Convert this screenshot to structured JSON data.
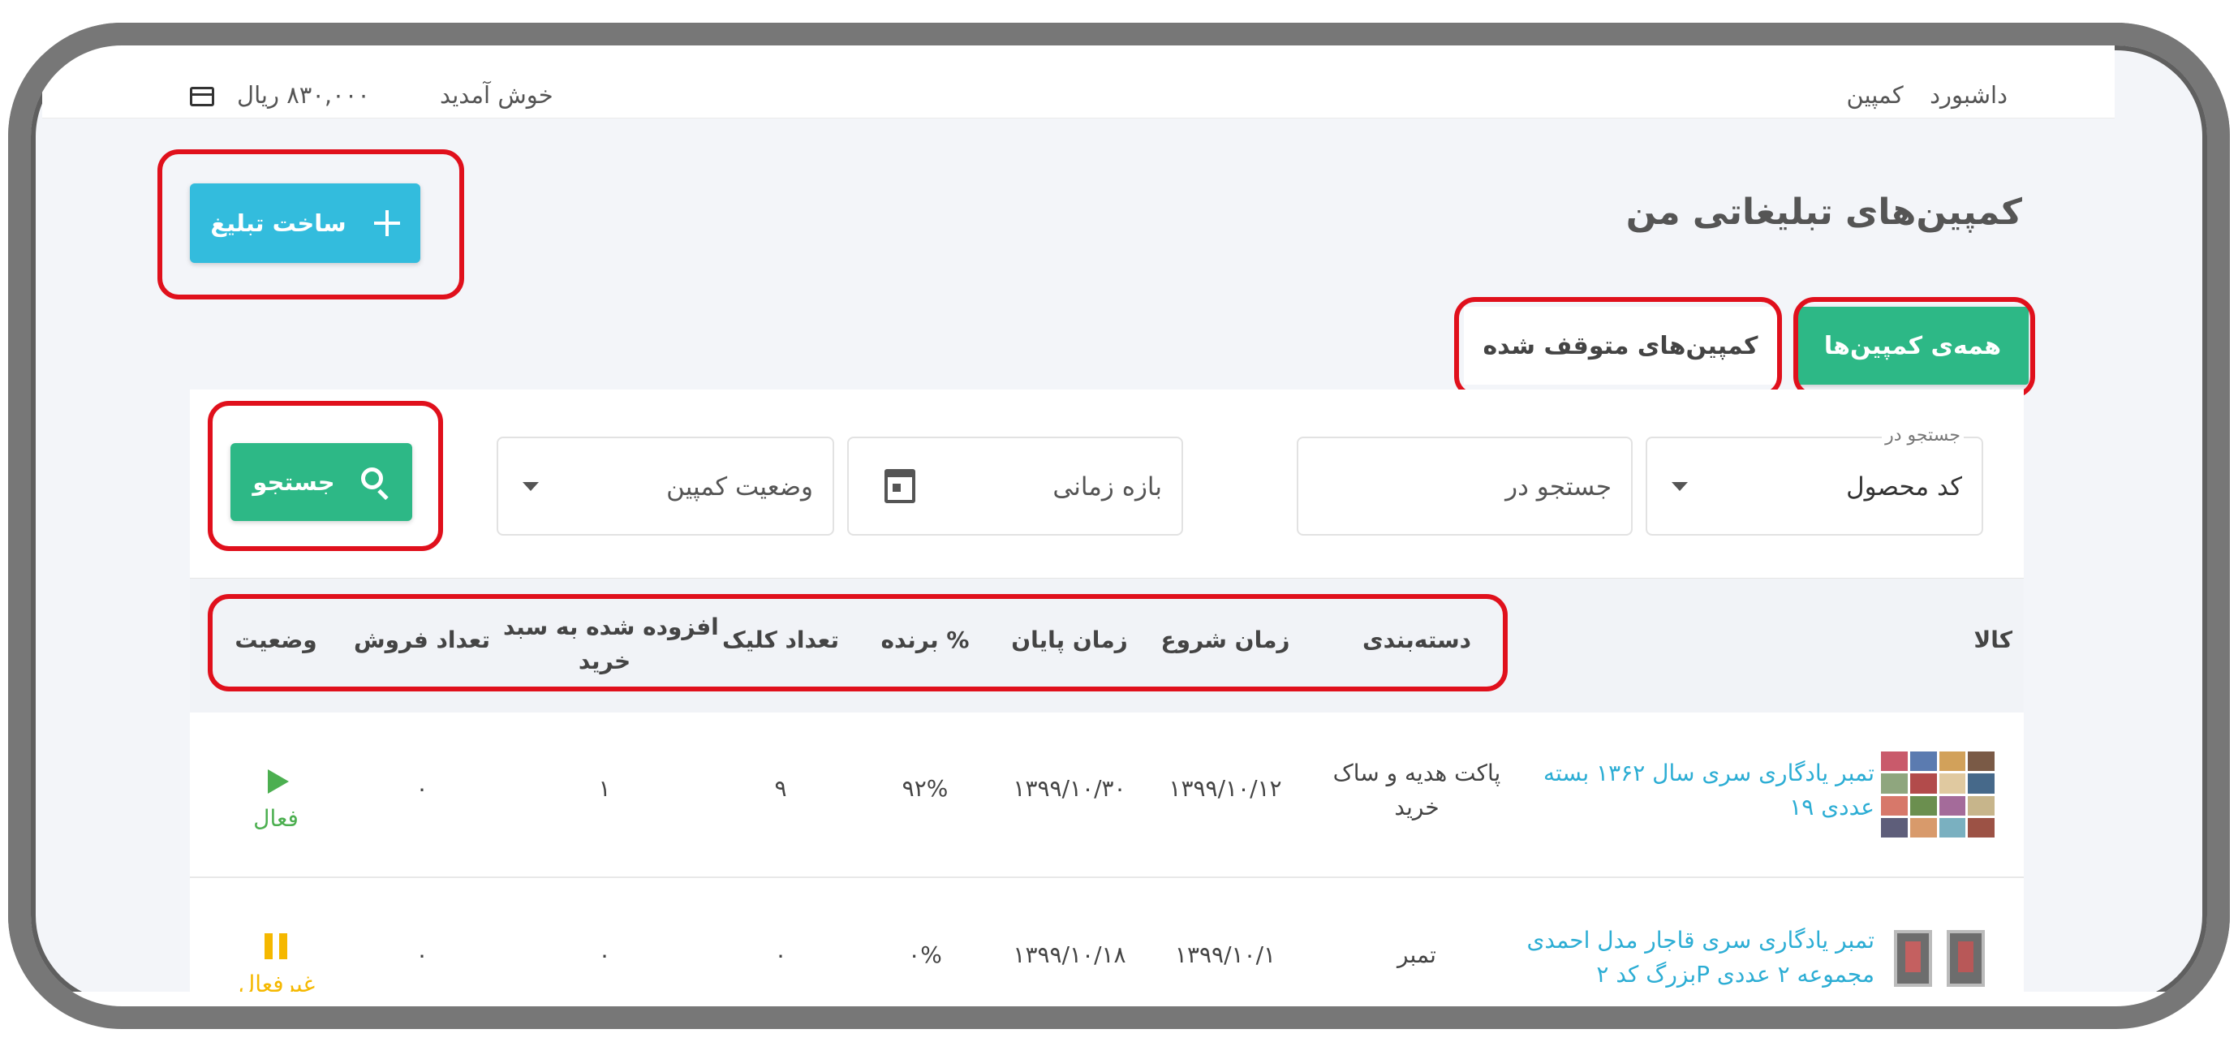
{
  "breadcrumb": {
    "dashboard": "داشبورد",
    "campaign": "کمپین"
  },
  "header": {
    "welcome": "خوش آمدید",
    "balance": "۸۳۰,۰۰۰ ریال",
    "wallet_icon": "wallet-icon"
  },
  "page": {
    "title": "کمپین‌های تبلیغاتی من",
    "create_button": "ساخت تبلیغ"
  },
  "tabs": [
    {
      "label": "همه‌ی کمپین‌ها",
      "active": true
    },
    {
      "label": "کمپین‌های متوقف شده",
      "active": false
    }
  ],
  "filters": {
    "search_in_label": "جستجو در",
    "search_in_value": "کد محصول",
    "search_input_placeholder": "جستجو در",
    "date_range_placeholder": "بازه زمانی",
    "status_placeholder": "وضعیت کمپین",
    "search_button": "جستجو"
  },
  "table": {
    "headers": {
      "product": "کالا",
      "category": "دسته‌بندی",
      "start": "زمان شروع",
      "end": "زمان پایان",
      "win": "برنده %",
      "clicks": "تعداد کلیک",
      "cart_line1": "افزوده شده به سبد",
      "cart_line2": "خرید",
      "sales": "تعداد فروش",
      "status": "وضعیت"
    },
    "rows": [
      {
        "product_line1": "تمبر یادگاری سری سال ۱۳۶۲ بسته",
        "product_line2": "۱۹ عددی",
        "category_line1": "پاکت هدیه و ساک",
        "category_line2": "خرید",
        "start": "۱۳۹۹/۱۰/۱۲",
        "end": "۱۳۹۹/۱۰/۳۰",
        "win": "۹۲%",
        "clicks": "۹",
        "cart": "۱",
        "sales": "۰",
        "status": "فعال"
      },
      {
        "product_line1": "تمبر یادگاری سری قاجار مدل احمدی",
        "product_line2": "بزرگ کد ۲P مجموعه ۲ عددی",
        "category_line1": "تمبر",
        "category_line2": "",
        "start": "۱۳۹۹/۱۰/۱",
        "end": "۱۳۹۹/۱۰/۱۸",
        "win": "۰%",
        "clicks": "۰",
        "cart": "۰",
        "sales": "۰",
        "status": "غیرفعال"
      }
    ]
  },
  "colors": {
    "green": "#2db886",
    "blue": "#33bcdd",
    "link": "#2cadd4",
    "active": "#4caf50",
    "inactive": "#f5b800",
    "highlight": "#e0101c"
  }
}
